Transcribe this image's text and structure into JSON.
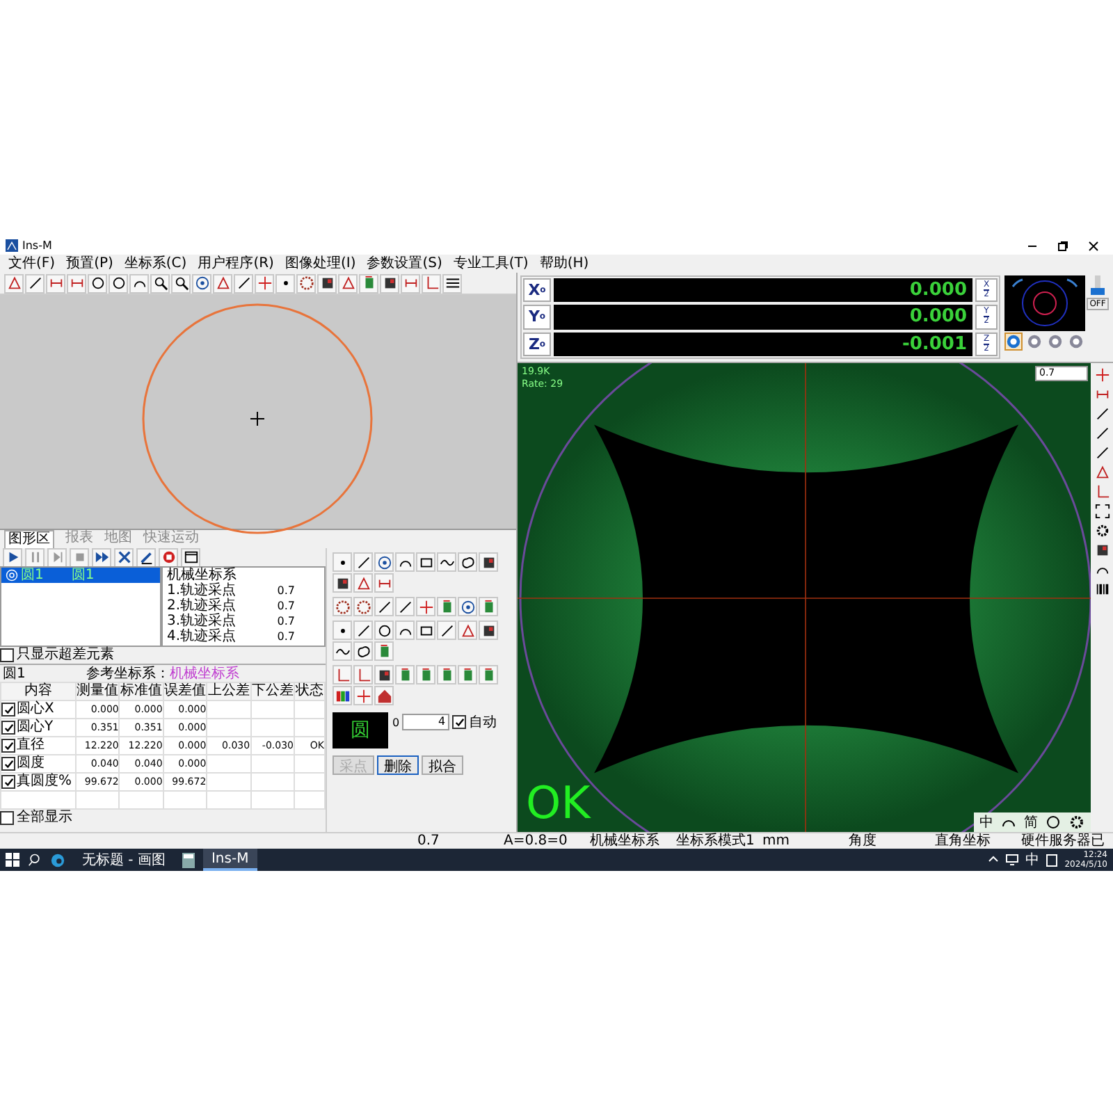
{
  "window": {
    "title": "Ins-M"
  },
  "menu": [
    {
      "label": "文件(F)"
    },
    {
      "label": "预置(P)"
    },
    {
      "label": "坐标系(C)"
    },
    {
      "label": "用户程序(R)"
    },
    {
      "label": "图像处理(I)"
    },
    {
      "label": "参数设置(S)"
    },
    {
      "label": "专业工具(T)"
    },
    {
      "label": "帮助(H)"
    }
  ],
  "graphic_tabs": [
    {
      "label": "图形区",
      "selected": true
    },
    {
      "label": "报表",
      "selected": false
    },
    {
      "label": "地图",
      "selected": false
    },
    {
      "label": "快速运动",
      "selected": false
    }
  ],
  "feature_tree": [
    {
      "name": "圆1",
      "reference": "圆1",
      "selected": true
    }
  ],
  "point_list": {
    "title": "机械坐标系",
    "points": [
      {
        "label": "1.轨迹采点",
        "value": "0.7"
      },
      {
        "label": "2.轨迹采点",
        "value": "0.7"
      },
      {
        "label": "3.轨迹采点",
        "value": "0.7"
      },
      {
        "label": "4.轨迹采点",
        "value": "0.7"
      }
    ]
  },
  "only_out_of_tolerance": {
    "label": "只显示超差元素",
    "checked": false
  },
  "result": {
    "element": "圆1",
    "reference_label": "参考坐标系：",
    "reference": "机械坐标系",
    "columns": [
      "内容",
      "测量值",
      "标准值",
      "误差值",
      "上公差",
      "下公差",
      "状态"
    ],
    "rows": [
      {
        "checked": true,
        "cells": [
          "圆心X",
          "0.000",
          "0.000",
          "0.000",
          "",
          "",
          ""
        ]
      },
      {
        "checked": true,
        "cells": [
          "圆心Y",
          "0.351",
          "0.351",
          "0.000",
          "",
          "",
          ""
        ]
      },
      {
        "checked": true,
        "cells": [
          "直径",
          "12.220",
          "12.220",
          "0.000",
          "0.030",
          "-0.030",
          "OK"
        ]
      },
      {
        "checked": true,
        "cells": [
          "圆度",
          "0.040",
          "0.040",
          "0.000",
          "",
          "",
          ""
        ]
      },
      {
        "checked": true,
        "cells": [
          "真圆度%",
          "99.672",
          "0.000",
          "99.672",
          "",
          "",
          ""
        ]
      }
    ]
  },
  "show_all": {
    "label": "全部显示",
    "checked": false
  },
  "element_preview": "圆",
  "point_count": {
    "start": "0",
    "value": "4"
  },
  "auto": {
    "label": "自动",
    "checked": true
  },
  "actions": [
    {
      "label": "采点",
      "disabled": true
    },
    {
      "label": "删除",
      "disabled": false
    },
    {
      "label": "拟合",
      "disabled": false
    }
  ],
  "dro": [
    {
      "axis": "X",
      "sub": "o",
      "value": "0.000",
      "half_num": "X",
      "half_den": "2"
    },
    {
      "axis": "Y",
      "sub": "o",
      "value": "0.000",
      "half_num": "Y",
      "half_den": "2"
    },
    {
      "axis": "Z",
      "sub": "o",
      "value": "-0.001",
      "half_num": "Z",
      "half_den": "2"
    }
  ],
  "light": {
    "level": 0.35,
    "off_label": "OFF",
    "modes": [
      {
        "selected": true
      },
      {
        "selected": false
      },
      {
        "selected": false
      },
      {
        "selected": false
      }
    ]
  },
  "camera": {
    "resolution": "19.9K",
    "rate": "Rate: 29",
    "verdict": "OK",
    "zoom": "0.7"
  },
  "status_bar": [
    "0.7",
    "A=0.8=0",
    "机械坐标系",
    "坐标系模式1",
    "mm",
    "角度",
    "直角坐标",
    "硬件服务器已"
  ],
  "ime": [
    "中",
    "简"
  ],
  "taskbar": {
    "apps": [
      {
        "label": "无标题 - 画图",
        "selected": false
      },
      {
        "label": "Ins-M",
        "selected": true
      }
    ],
    "tray_ime": "中",
    "time": "12:24",
    "date": "2024/5/10"
  }
}
